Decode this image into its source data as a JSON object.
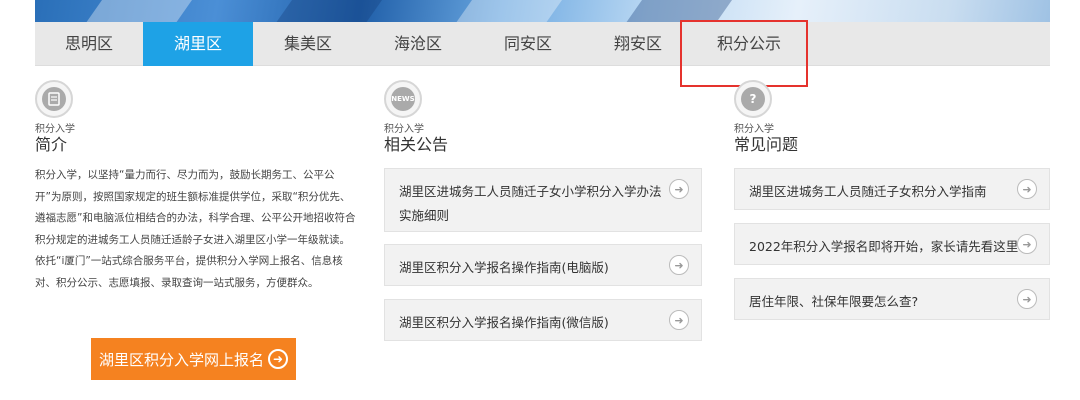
{
  "tabs": [
    {
      "label": "思明区"
    },
    {
      "label": "湖里区"
    },
    {
      "label": "集美区"
    },
    {
      "label": "海沧区"
    },
    {
      "label": "同安区"
    },
    {
      "label": "翔安区"
    },
    {
      "label": "积分公示"
    }
  ],
  "active_tab": "湖里区",
  "accent_color": "#1ea2e6",
  "button_color": "#f58220",
  "highlight_color": "#e5322d",
  "intro": {
    "icon": "document-icon",
    "small_label": "积分入学",
    "title": "简介",
    "paragraphs": [
      "积分入学，以坚持“量力而行、尽力而为，鼓励长期务工、公平公开”为原则，按照国家规定的班生额标准提供学位，采取“积分优先、遴福志愿”和电脑派位相结合的办法，科学合理、公平公开地招收符合积分规定的进城务工人员随迁适龄子女进入湖里区小学一年级就读。",
      "依托“i厦门”一站式综合服务平台，提供积分入学网上报名、信息核对、积分公示、志愿填报、录取查询一站式服务，方便群众。"
    ],
    "enroll_button": "湖里区积分入学网上报名"
  },
  "notices": {
    "icon": "news-icon",
    "icon_text": "NEWS",
    "small_label": "积分入学",
    "title": "相关公告",
    "items": [
      {
        "line1": "湖里区进城务工人员随迁子女小学积分入学办法",
        "line2": "实施细则"
      },
      {
        "line1": "湖里区积分入学报名操作指南(电脑版)",
        "line2": ""
      },
      {
        "line1": "湖里区积分入学报名操作指南(微信版)",
        "line2": ""
      }
    ]
  },
  "faq": {
    "icon": "question-icon",
    "small_label": "积分入学",
    "title": "常见问题",
    "items": [
      {
        "label": "湖里区进城务工人员随迁子女积分入学指南"
      },
      {
        "label": "2022年积分入学报名即将开始，家长请先看这里"
      },
      {
        "label": "居住年限、社保年限要怎么查?"
      }
    ]
  }
}
